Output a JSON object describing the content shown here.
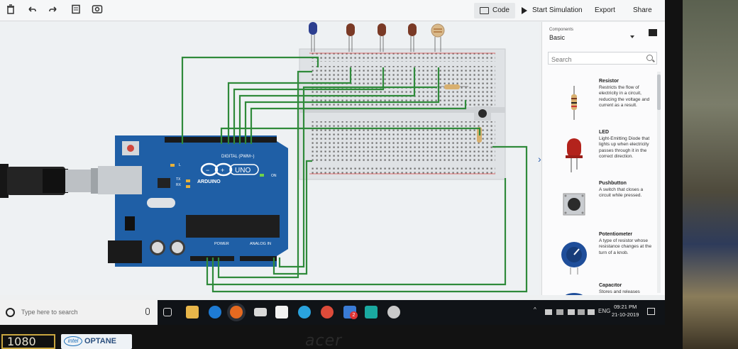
{
  "toolbar": {
    "icons": [
      "trash-icon",
      "undo-icon",
      "redo-icon",
      "notes-icon",
      "visibility-icon"
    ],
    "code_label": "Code",
    "simulate_label": "Start Simulation",
    "export_label": "Export",
    "share_label": "Share"
  },
  "panel": {
    "components_label": "Components",
    "components_value": "Basic",
    "search_placeholder": "Search",
    "collapse_glyph": "›",
    "items": [
      {
        "name": "Resistor",
        "desc": "Restricts the flow of electricity in a circuit, reducing the voltage and current as a result.",
        "icon": "resistor-icon"
      },
      {
        "name": "LED",
        "desc": "Light-Emitting Diode that lights up when electricity passes through it in the correct direction.",
        "icon": "led-icon"
      },
      {
        "name": "Pushbutton",
        "desc": "A switch that closes a circuit while pressed.",
        "icon": "pushbutton-icon"
      },
      {
        "name": "Potentiometer",
        "desc": "A type of resistor whose resistance changes at the turn of a knob.",
        "icon": "potentiometer-icon"
      },
      {
        "name": "Capacitor",
        "desc": "Stores and releases",
        "icon": "capacitor-icon"
      }
    ]
  },
  "board": {
    "label_digital": "DIGITAL (PWM~)",
    "label_arduino": "ARDUINO",
    "label_uno": "UNO",
    "label_power": "POWER",
    "label_analog": "ANALOG IN",
    "label_on": "ON",
    "label_l": "L",
    "label_tx": "TX",
    "label_rx": "RX"
  },
  "colors": {
    "wire": "#2f8a3a",
    "board": "#1f5fa6",
    "led_blue": "#2c3e8f",
    "led_red": "#7a3a26",
    "accent": "#2a5db0"
  },
  "taskbar": {
    "search_placeholder": "Type here to search",
    "time": "09:21 PM",
    "date": "21-10-2019",
    "language": "ENG",
    "badge_count": "2",
    "apps": [
      "task-view-icon",
      "file-explorer-icon",
      "edge-icon",
      "firefox-icon",
      "mail-icon",
      "store-icon",
      "telegram-icon",
      "chrome-icon",
      "app-icon",
      "photos-icon",
      "snipping-icon"
    ]
  },
  "laptop": {
    "brand": "acer",
    "sticker_res": "1080",
    "sticker_intel": "intel",
    "sticker_optane": "OPTANE"
  }
}
